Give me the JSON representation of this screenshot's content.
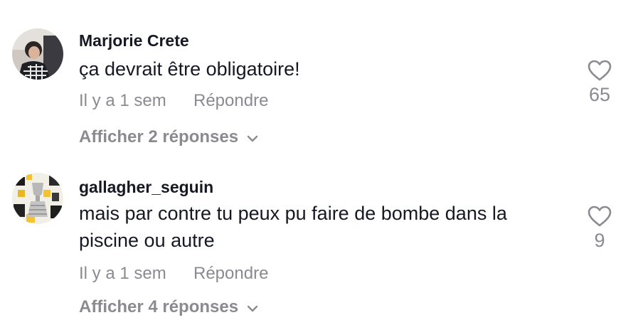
{
  "comments": [
    {
      "username": "Marjorie Crete",
      "text": "ça devrait être obligatoire!",
      "time": "Il y a 1 sem",
      "reply_label": "Répondre",
      "view_replies": "Afficher 2 réponses",
      "likes": "65",
      "avatar_icon": "profile-photo",
      "like_icon": "heart-outline-icon"
    },
    {
      "username": "gallagher_seguin",
      "text": "mais par contre tu peux pu faire de bombe dans la piscine ou autre",
      "time": "Il y a 1 sem",
      "reply_label": "Répondre",
      "view_replies": "Afficher 4 réponses",
      "likes": "9",
      "avatar_icon": "profile-photo",
      "like_icon": "heart-outline-icon"
    }
  ],
  "colors": {
    "primary_text": "#161823",
    "secondary_text": "#8a8b91"
  }
}
